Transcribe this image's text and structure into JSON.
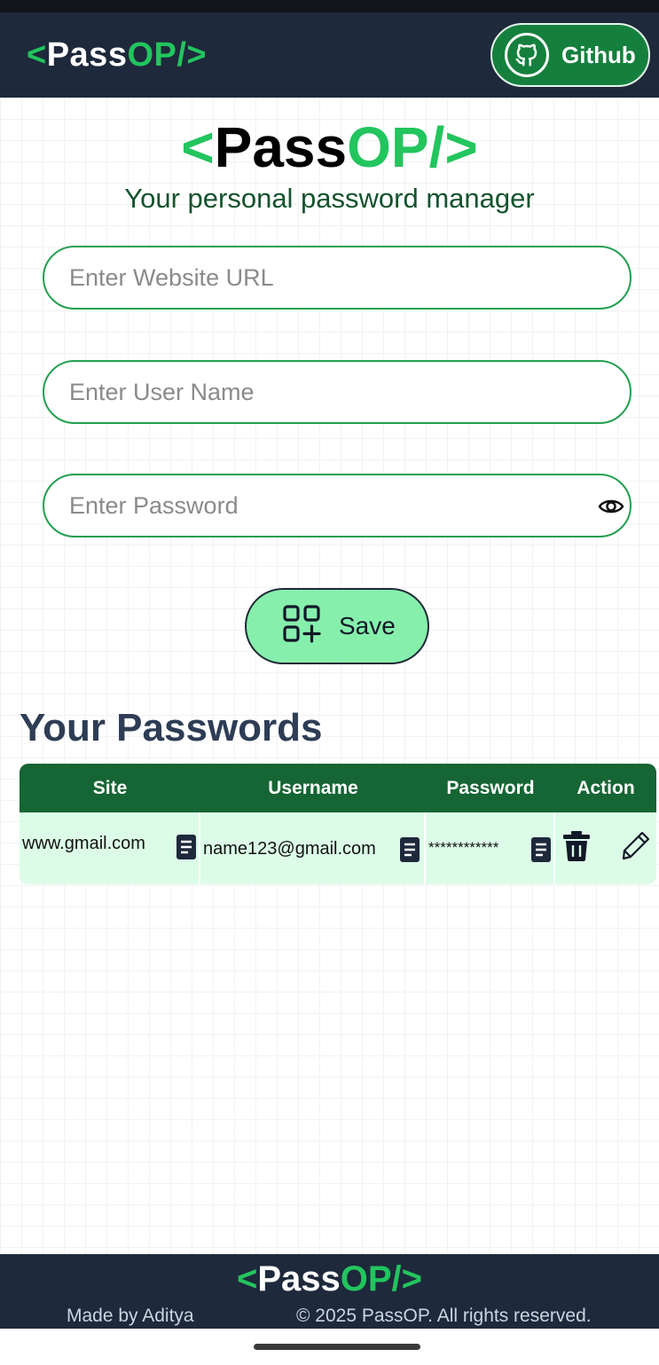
{
  "navbar": {
    "logo": {
      "open": "<",
      "pass": "Pass",
      "op": "OP/>"
    },
    "github_label": "Github"
  },
  "hero": {
    "logo": {
      "open": "<",
      "pass": "Pass",
      "op": "OP/>"
    },
    "tagline": "Your personal password manager"
  },
  "form": {
    "url_placeholder": "Enter Website URL",
    "username_placeholder": "Enter User Name",
    "password_placeholder": "Enter Password",
    "save_label": "Save"
  },
  "passwords": {
    "title": "Your Passwords",
    "columns": [
      "Site",
      "Username",
      "Password",
      "Action"
    ],
    "rows": [
      {
        "site": "www.gmail.com",
        "username": "name123@gmail.com",
        "password": "************"
      }
    ]
  },
  "footer": {
    "logo": {
      "open": "<",
      "pass": "Pass",
      "op": "OP/>"
    },
    "made_by": "Made by Aditya",
    "copyright": "© 2025 PassOP. All rights reserved."
  },
  "colors": {
    "accent": "#22c55e",
    "navbar_bg": "#1e293b",
    "table_header": "#166534",
    "table_row": "#dcfce7",
    "save_button": "#86efac"
  },
  "icons": [
    "github-icon",
    "eye-icon",
    "add-grid-icon",
    "copy-icon",
    "trash-icon",
    "edit-icon"
  ]
}
